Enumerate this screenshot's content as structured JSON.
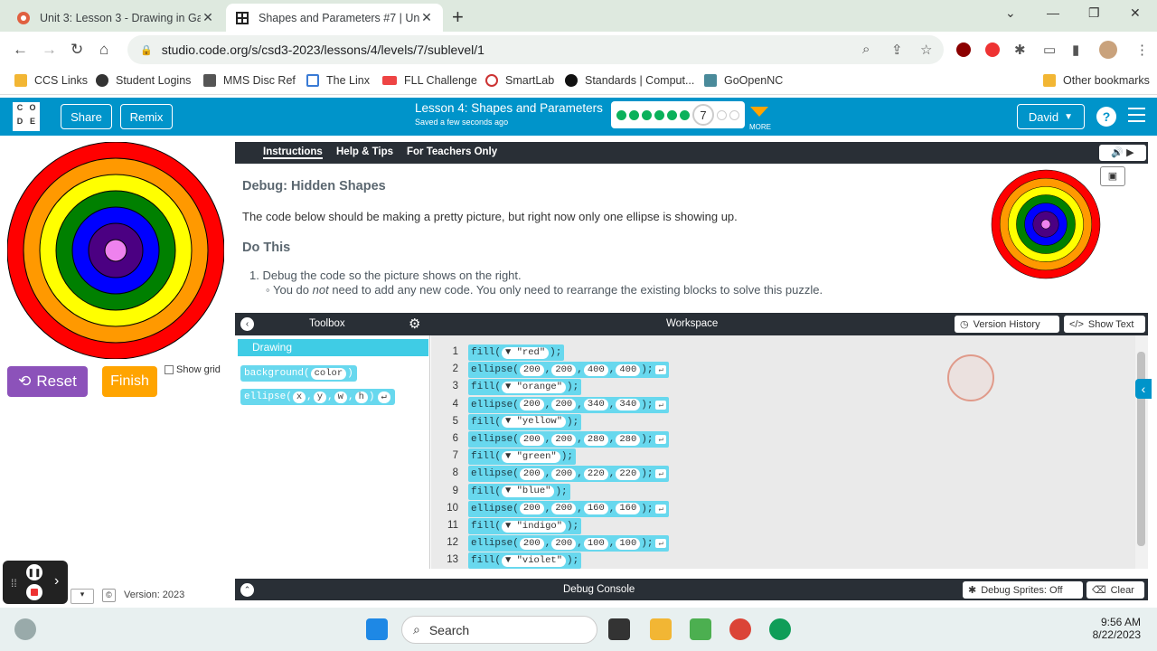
{
  "browser": {
    "tabs": [
      {
        "title": "Unit 3: Lesson 3 - Drawing in Gam",
        "active": false
      },
      {
        "title": "Shapes and Parameters #7 | Unit",
        "active": true
      }
    ],
    "url": "studio.code.org/s/csd3-2023/lessons/4/levels/7/sublevel/1",
    "bookmarks": [
      "CCS Links",
      "Student Logins",
      "MMS Disc Ref",
      "The Linx",
      "FLL Challenge",
      "SmartLab",
      "Standards | Comput...",
      "GoOpenNC"
    ],
    "other_bookmarks": "Other bookmarks"
  },
  "header": {
    "logo_letters": [
      "C",
      "O",
      "D",
      "E"
    ],
    "share": "Share",
    "remix": "Remix",
    "lesson_title": "Lesson 4: Shapes and Parameters",
    "saved": "Saved a few seconds ago",
    "current_level": "7",
    "more": "MORE",
    "user": "David",
    "help": "?"
  },
  "controls": {
    "reset": "Reset",
    "finish": "Finish",
    "show_grid": "Show grid",
    "version": "Version: 2023"
  },
  "instructions": {
    "tabs": [
      "Instructions",
      "Help & Tips",
      "For Teachers Only"
    ],
    "title": "Debug: Hidden Shapes",
    "description": "The code below should be making a pretty picture, but right now only one ellipse is showing up.",
    "do_this": "Do This",
    "step1": "1. Debug the code so the picture shows on the right.",
    "step1_sub_pre": "You do ",
    "step1_sub_em": "not",
    "step1_sub_post": " need to add any new code. You only need to rearrange the existing blocks to solve this puzzle."
  },
  "toolbox": {
    "title": "Toolbox",
    "category": "Drawing",
    "blocks": [
      {
        "name": "background",
        "args": [
          "color"
        ]
      },
      {
        "name": "ellipse",
        "args": [
          "x",
          "y",
          "w",
          "h"
        ]
      }
    ]
  },
  "workspace": {
    "title": "Workspace",
    "version_history": "Version History",
    "show_text": "Show Text",
    "lines": [
      {
        "n": "1",
        "type": "fill",
        "color": "\"red\""
      },
      {
        "n": "2",
        "type": "ellipse",
        "args": [
          "200",
          "200",
          "400",
          "400"
        ]
      },
      {
        "n": "3",
        "type": "fill",
        "color": "\"orange\""
      },
      {
        "n": "4",
        "type": "ellipse",
        "args": [
          "200",
          "200",
          "340",
          "340"
        ]
      },
      {
        "n": "5",
        "type": "fill",
        "color": "\"yellow\""
      },
      {
        "n": "6",
        "type": "ellipse",
        "args": [
          "200",
          "200",
          "280",
          "280"
        ]
      },
      {
        "n": "7",
        "type": "fill",
        "color": "\"green\""
      },
      {
        "n": "8",
        "type": "ellipse",
        "args": [
          "200",
          "200",
          "220",
          "220"
        ]
      },
      {
        "n": "9",
        "type": "fill",
        "color": "\"blue\""
      },
      {
        "n": "10",
        "type": "ellipse",
        "args": [
          "200",
          "200",
          "160",
          "160"
        ]
      },
      {
        "n": "11",
        "type": "fill",
        "color": "\"indigo\""
      },
      {
        "n": "12",
        "type": "ellipse",
        "args": [
          "200",
          "200",
          "100",
          "100"
        ]
      },
      {
        "n": "13",
        "type": "fill",
        "color": "\"violet\""
      }
    ]
  },
  "debug": {
    "title": "Debug Console",
    "sprites": "Debug Sprites: Off",
    "clear": "Clear"
  },
  "taskbar": {
    "search": "Search",
    "time": "9:56 AM",
    "date": "8/22/2023"
  },
  "colors": {
    "accent": "#0094ca",
    "block": "#68d8ee",
    "rings": [
      "#ff0000",
      "#ff9900",
      "#ffff00",
      "#008000",
      "#0000ff",
      "#4b0082",
      "#ee82ee"
    ]
  }
}
